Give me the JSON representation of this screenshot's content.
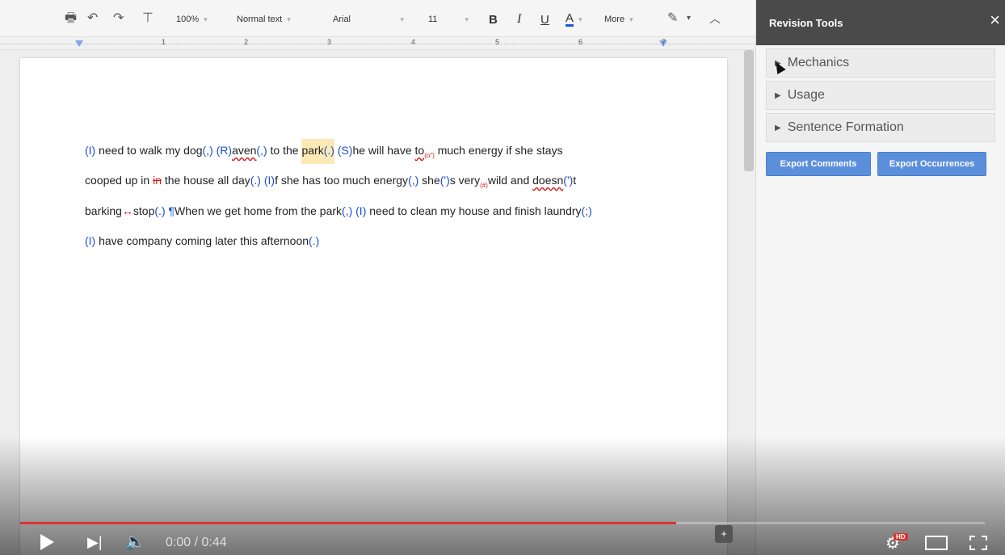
{
  "toolbar": {
    "zoom": "100%",
    "style": "Normal text",
    "font": "Arial",
    "size": "11",
    "bold": "B",
    "italic": "I",
    "underline": "U",
    "text_color": "A",
    "more": "More"
  },
  "ruler": {
    "numbers": [
      "1",
      "2",
      "3",
      "4",
      "5",
      "6",
      "7"
    ]
  },
  "document": {
    "line1": {
      "p1": "(I)",
      "p2": " need to walk my dog",
      "p3": "(,)",
      "p4": " ",
      "p5": "(R)",
      "p6": "aven",
      "p7": "(,)",
      "p8": " to the ",
      "p9": "park",
      "p10": "(.)",
      "p11": " ",
      "p12": "(S)",
      "p13": "he will have ",
      "p14": "to",
      "p15": "(o\")",
      "p16": " much energy if she stays"
    },
    "line2": {
      "p1": "cooped up in ",
      "p2": "in",
      "p3": " the house all day",
      "p4": "(.)",
      "p5": " ",
      "p6": "(I)",
      "p7": "f she has too much energy",
      "p8": "(,)",
      "p9": " she",
      "p10": "(')",
      "p11": "s very",
      "p12": "(#)",
      "p13": "wild and ",
      "p14": "doesn",
      "p15": "(')",
      "p16": "t"
    },
    "line3": {
      "p1": "barking",
      "p2": "↔",
      "p3": "stop",
      "p4": "(.)",
      "p5": " ¶",
      "p6": "When we get home from the park",
      "p7": "(,)",
      "p8": " ",
      "p9": "(I)",
      "p10": " need to clean my house and finish laundry",
      "p11": "(;)"
    },
    "line4": {
      "p1": "(I)",
      "p2": " have company coming later this afternoon",
      "p3": "(.)"
    }
  },
  "panel": {
    "title": "Revision Tools",
    "close": "×",
    "sections": [
      "Mechanics",
      "Usage",
      "Sentence Formation"
    ],
    "export_comments": "Export Comments",
    "export_occurrences": "Export Occurrences"
  },
  "video": {
    "time": "0:00 / 0:44",
    "hd_badge": "HD",
    "progress": 0.68
  },
  "colors": {
    "correction_blue": "#1b4fd1",
    "correction_red": "#d21c1c",
    "highlight": "#fce9b6",
    "button_blue": "#5b8fdb",
    "panel_header": "#4a4a4a"
  }
}
